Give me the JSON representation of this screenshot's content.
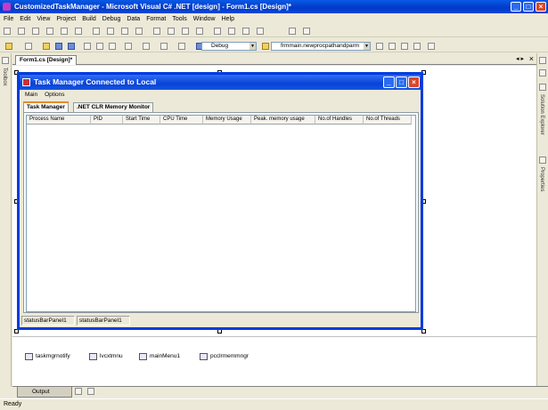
{
  "window": {
    "title": "CustomizedTaskManager - Microsoft Visual C# .NET [design] - Form1.cs [Design]*"
  },
  "menu": [
    "File",
    "Edit",
    "View",
    "Project",
    "Build",
    "Debug",
    "Data",
    "Format",
    "Tools",
    "Window",
    "Help"
  ],
  "toolbar": {
    "config": "Debug",
    "target": "frmmain.newprocpathandparm"
  },
  "sidebar": {
    "left": "Toolbox",
    "right_top": "Solution Explorer",
    "right_bottom": "Properties"
  },
  "doc_tab": "Form1.cs [Design]*",
  "form": {
    "title": "Task Manager Connected to Local",
    "menu": [
      "Main",
      "Options"
    ],
    "tabs": [
      "Task Manager",
      ".NET CLR Memory Monitor"
    ],
    "columns": [
      "Process Name",
      "PID",
      "Start Time",
      "CPU Time",
      "Memory Usage",
      "Peak. memory usage",
      "No.of Handles",
      "No.of Threads"
    ],
    "status_panels": [
      "statusBarPanel1",
      "statusBarPanel1"
    ]
  },
  "tray": [
    "taskmgrnotify",
    "lvcxtmnu",
    "mainMenu1",
    "pcclrmemmngr"
  ],
  "bottom": {
    "output_tab": "Output"
  },
  "status": "Ready"
}
